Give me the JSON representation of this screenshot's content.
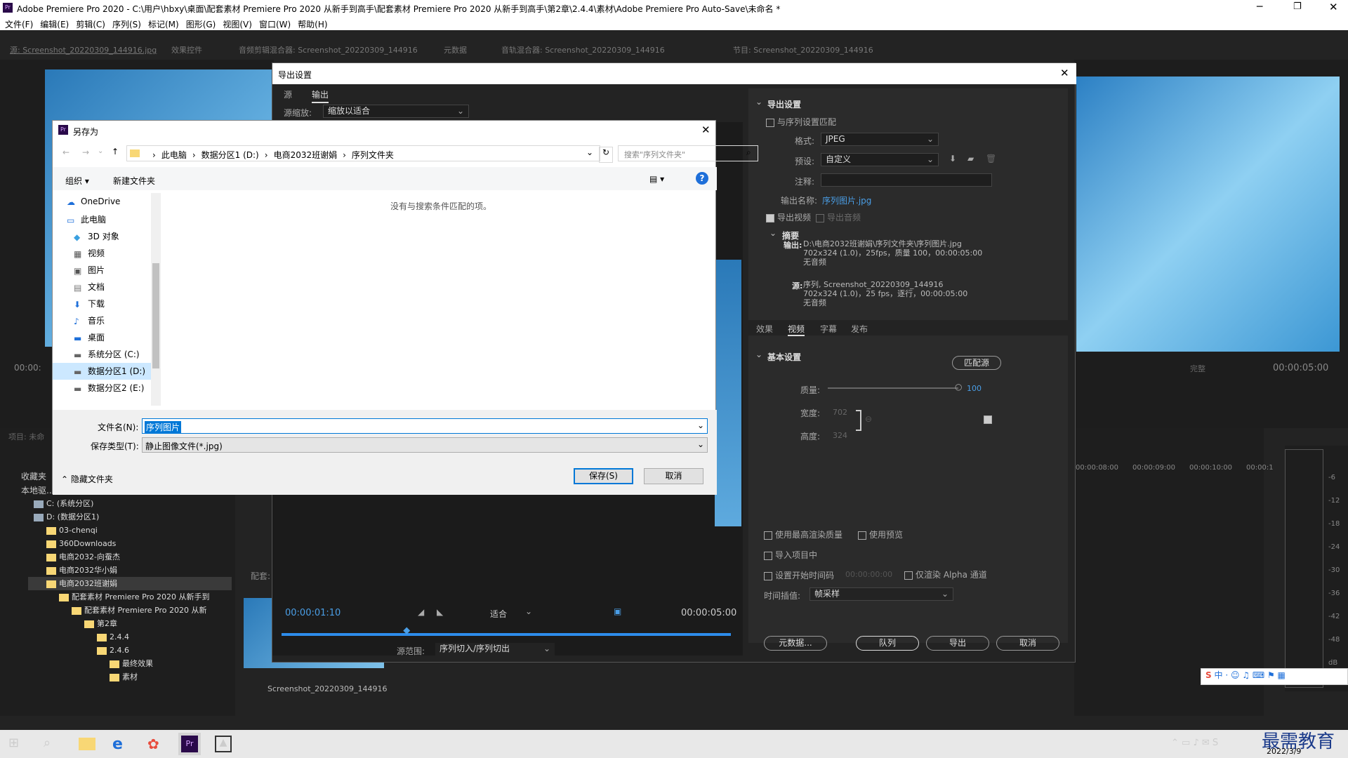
{
  "window": {
    "title": "Adobe Premiere Pro 2020 - C:\\用户\\hbxy\\桌面\\配套素材 Premiere Pro 2020 从新手到高手\\配套素材 Premiere Pro 2020 从新手到高手\\第2章\\2.4.4\\素材\\Adobe Premiere Pro Auto-Save\\未命名 *",
    "app_icon": "Pr"
  },
  "menu": [
    "文件(F)",
    "编辑(E)",
    "剪辑(C)",
    "序列(S)",
    "标记(M)",
    "图形(G)",
    "视图(V)",
    "窗口(W)",
    "帮助(H)"
  ],
  "panel_tabs": [
    "源: Screenshot_20220309_144916.jpg",
    "效果控件",
    "音频剪辑混合器: Screenshot_20220309_144916",
    "元数据",
    "音轨混合器: Screenshot_20220309_144916",
    "节目: Screenshot_20220309_144916"
  ],
  "bg": {
    "timecode_left": "00:00:",
    "timecode_right": "00:00:05:00",
    "quality": "完整",
    "project_label": "项目: 未命",
    "favorites": "收藏夹",
    "local_drive": "本地驱...",
    "clip_label": "配套:",
    "clip_name": "Screenshot_20220309_144916",
    "ruler": [
      "00:00:08:00",
      "00:00:09:00",
      "00:00:10:00",
      "00:00:1"
    ],
    "meter": [
      "-6",
      "-12",
      "-18",
      "-24",
      "-30",
      "-36",
      "-42",
      "-48",
      "dB"
    ],
    "tree": [
      {
        "label": "C: (系统分区)",
        "indent": 1
      },
      {
        "label": "D: (数据分区1)",
        "indent": 1
      },
      {
        "label": "03-chenqi",
        "indent": 2
      },
      {
        "label": "360Downloads",
        "indent": 2
      },
      {
        "label": "电商2032-向蚕杰",
        "indent": 2
      },
      {
        "label": "电商2032华小娟",
        "indent": 2
      },
      {
        "label": "电商2032班谢娟",
        "indent": 2
      },
      {
        "label": "配套素材 Premiere Pro 2020 从新手到",
        "indent": 3
      },
      {
        "label": "配套素材 Premiere Pro 2020 从新",
        "indent": 4
      },
      {
        "label": "第2章",
        "indent": 5
      },
      {
        "label": "2.4.4",
        "indent": 6
      },
      {
        "label": "2.4.6",
        "indent": 6
      },
      {
        "label": "最终效果",
        "indent": 7
      },
      {
        "label": "素材",
        "indent": 7
      }
    ]
  },
  "export": {
    "title": "导出设置",
    "tabs": [
      "源",
      "输出"
    ],
    "source_scale_label": "源缩放:",
    "source_scale": "缩放以适合",
    "section": "导出设置",
    "match_seq": "与序列设置匹配",
    "format_label": "格式:",
    "format": "JPEG",
    "preset_label": "预设:",
    "preset": "自定义",
    "notes_label": "注释:",
    "output_name_label": "输出名称:",
    "output_name": "序列图片.jpg",
    "export_video": "导出视频",
    "export_audio": "导出音频",
    "summary_title": "摘要",
    "summary_output_label": "输出:",
    "summary_output": [
      "D:\\电商2032班谢娟\\序列文件夹\\序列图片.jpg",
      "702x324 (1.0)，25fps，质量 100，00:00:05:00",
      "无音频"
    ],
    "summary_source_label": "源:",
    "summary_source": [
      "序列, Screenshot_20220309_144916",
      "702x324 (1.0)，25 fps，逐行，00:00:05:00",
      "无音频"
    ],
    "subtabs": [
      "效果",
      "视频",
      "字幕",
      "发布"
    ],
    "basic": "基本设置",
    "match_source": "匹配源",
    "quality_label": "质量:",
    "quality": "100",
    "width_label": "宽度:",
    "width": "702",
    "height_label": "高度:",
    "height": "324",
    "max_quality": "使用最高渲染质量",
    "use_preview": "使用预览",
    "import_project": "导入项目中",
    "set_start_tc": "设置开始时间码",
    "start_tc": "00:00:00:00",
    "alpha_only": "仅渲染 Alpha 通道",
    "interp_label": "时间插值:",
    "interp": "帧采样",
    "btn_metadata": "元数据...",
    "btn_queue": "队列",
    "btn_export": "导出",
    "btn_cancel": "取消",
    "tc_current": "00:00:01:10",
    "tc_end": "00:00:05:00",
    "fit": "适合",
    "range_label": "源范围:",
    "range": "序列切入/序列切出",
    "playhead_fraction": 0.28
  },
  "saveas": {
    "title": "另存为",
    "breadcrumb": [
      "此电脑",
      "数据分区1 (D:)",
      "电商2032班谢娟",
      "序列文件夹"
    ],
    "search_placeholder": "搜索\"序列文件夹\"",
    "organize": "组织",
    "new_folder": "新建文件夹",
    "empty_msg": "没有与搜索条件匹配的项。",
    "nav": [
      {
        "label": "OneDrive",
        "icon": "cloud-icon",
        "level": 0
      },
      {
        "label": "此电脑",
        "icon": "pc-icon",
        "level": 0
      },
      {
        "label": "3D 对象",
        "icon": "cube-icon",
        "level": 1
      },
      {
        "label": "视频",
        "icon": "video-icon",
        "level": 1
      },
      {
        "label": "图片",
        "icon": "picture-icon",
        "level": 1
      },
      {
        "label": "文档",
        "icon": "document-icon",
        "level": 1
      },
      {
        "label": "下载",
        "icon": "download-icon",
        "level": 1
      },
      {
        "label": "音乐",
        "icon": "music-icon",
        "level": 1
      },
      {
        "label": "桌面",
        "icon": "desktop-icon",
        "level": 1
      },
      {
        "label": "系统分区 (C:)",
        "icon": "drive-icon",
        "level": 1
      },
      {
        "label": "数据分区1 (D:)",
        "icon": "drive-icon",
        "level": 1,
        "selected": true
      },
      {
        "label": "数据分区2 (E:)",
        "icon": "drive-icon",
        "level": 1
      }
    ],
    "filename_label": "文件名(N):",
    "filename": "序列图片",
    "filetype_label": "保存类型(T):",
    "filetype": "静止图像文件(*.jpg)",
    "hide_folders": "隐藏文件夹",
    "save": "保存(S)",
    "cancel": "取消"
  },
  "taskbar": {
    "date": "2022/3/9",
    "watermark": "最需教育",
    "ime": "中"
  },
  "colors": {
    "accent": "#2d8ceb",
    "pr_purple": "#2a0a4a"
  }
}
